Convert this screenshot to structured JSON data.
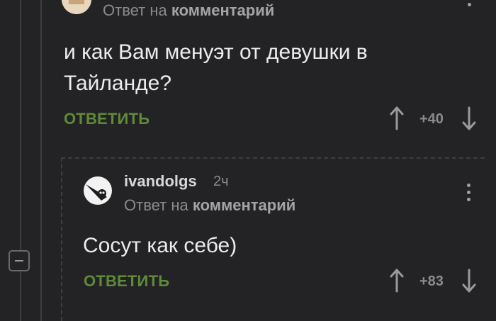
{
  "comment1": {
    "meta_prefix": "Ответ на",
    "meta_target": "комментарий",
    "text_line1": "и как Вам менуэт от девушки в",
    "text_line2": "Тайланде?",
    "reply_label": "ОТВЕТИТЬ",
    "rating": "+40"
  },
  "comment2": {
    "username": "ivandolgs",
    "time": "2ч",
    "meta_prefix": "Ответ на",
    "meta_target": "комментарий",
    "text": "Сосут как себе)",
    "reply_label": "ОТВЕТИТЬ",
    "rating": "+83"
  },
  "colors": {
    "background": "#232325",
    "reply_green": "#5f8a3a",
    "muted_text": "#8b8b8d"
  }
}
